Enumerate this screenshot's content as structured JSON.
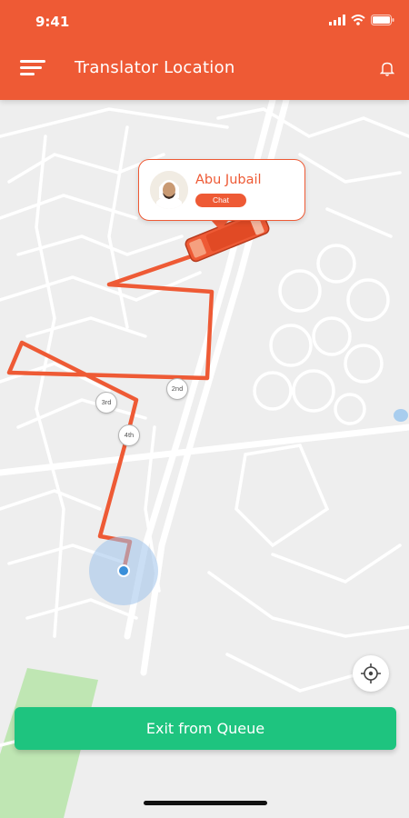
{
  "status_bar": {
    "time": "9:41"
  },
  "header": {
    "title": "Translator Location",
    "menu_icon": "hamburger-menu-icon",
    "notification_icon": "bell-icon"
  },
  "driver": {
    "name": "Abu Jubail",
    "chat_label": "Chat",
    "avatar_icon": "person-avatar"
  },
  "route": {
    "waypoints": [
      "2nd",
      "3rd",
      "4th"
    ]
  },
  "actions": {
    "exit_label": "Exit from Queue",
    "locate_icon": "crosshair-icon"
  },
  "colors": {
    "primary": "#ee5a35",
    "success": "#1ec47f",
    "user_location": "#3a8fd9"
  }
}
